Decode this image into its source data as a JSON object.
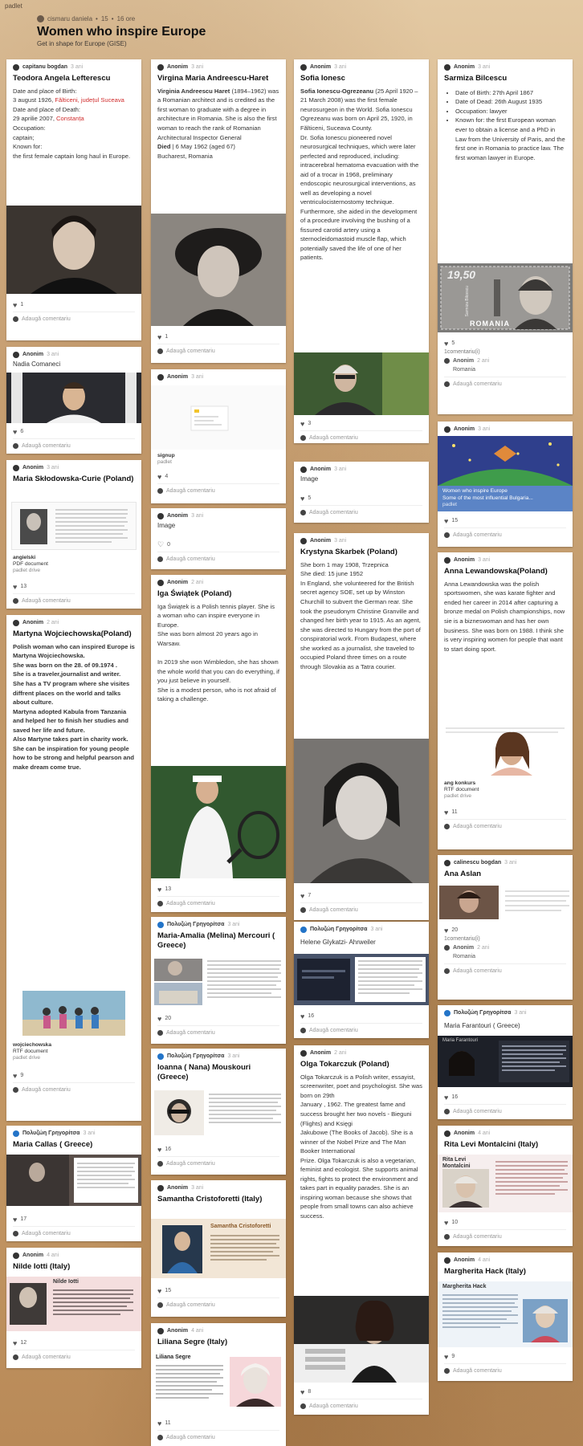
{
  "brand": "padlet",
  "header": {
    "author": "cismaru daniela",
    "likes": "15",
    "age": "16 ore",
    "title": "Women who inspire Europe",
    "subtitle": "Get in shape for Europe (GISE)",
    "dot": "•"
  },
  "ui": {
    "add_comment": "Adaugă comentariu",
    "heart": "♥",
    "heart_empty": "♡"
  },
  "cards": {
    "teodora": {
      "author": "capitanu bogdan",
      "time": "3 ani",
      "title": "Teodora Angela Lefterescu",
      "l1": "Date and place of Birth:",
      "l2a": "3 august 1926, ",
      "l2b": "Fălticeni, județul Suceava",
      "l3": "Date and place of Death:",
      "l4a": "29 aprilie 2007, ",
      "l4b": "Constanța",
      "l5": "Occupation:",
      "l6": "captain;",
      "l7": "Known for:",
      "l8": "the first female captain long haul in Europe.",
      "likes": "1"
    },
    "nadia": {
      "author": "Anonim",
      "time": "3 ani",
      "title": "Nadia Comaneci",
      "likes": "6"
    },
    "curie": {
      "author": "Anonim",
      "time": "3 ani",
      "title": "Maria Skłodowska-Curie (Poland)",
      "file": "angielski",
      "ftype": "PDF document",
      "src": "padlet drive",
      "likes": "13"
    },
    "martyna": {
      "author": "Anonim",
      "time": "2 ani",
      "title": "Martyna Wojciechowska(Poland)",
      "body": "Polish woman who can inspired Europe is Martyna Wojciechowska.\nShe was born on  the 28. of 09.1974 .\nShe is a traveler,journalist and writer.\nShe has  a TV program where she visites diffrent places on the world and talks about culture.\n Martyna adopted Kabula from Tanzania and helped her to finish her studies and saved her life and future.\nAlso Martyne takes part in charity work.\nShe can be inspiration for young people how to be  strong and helpful pearson and make dream come true.",
      "file": "wojciechowska",
      "ftype": "RTF document",
      "src": "padlet drive",
      "likes": "9"
    },
    "callas": {
      "author": "Πολυζώη Γρηγορίτσα",
      "time": "3 ani",
      "title": "Maria Callas ( Greece)",
      "likes": "17"
    },
    "iotti": {
      "author": "Anonim",
      "time": "4 ani",
      "title": "Nilde Iotti (Italy)",
      "caption": "Nilde Iotti",
      "likes": "12"
    },
    "virginia": {
      "author": "Anonim",
      "time": "3 ani",
      "title": "Virgina Maria Andreescu-Haret",
      "bname": "Virginia Andreescu Haret",
      "body": " (1894–1962) was a Romanian architect and is credited as the first woman to graduate with a degree in architecture in Romania. She is also the first woman to reach the rank of Romanian Architectural Inspector General",
      "died": "Died",
      "dieddate": " | 6 May 1962 (aged 67)",
      "place": "Bucharest, Romania",
      "likes": "1"
    },
    "signup": {
      "author": "Anonim",
      "time": "3 ani",
      "link": "signup",
      "src": "padlet",
      "likes": "4"
    },
    "image1": {
      "author": "Anonim",
      "time": "3 ani",
      "title": "Image",
      "likes": "0"
    },
    "iga": {
      "author": "Anonim",
      "time": "2 ani",
      "title": "Iga Świątek (Poland)",
      "body": "Iga Świątek is a Polish tennis player. She is a woman who can inspire everyone in Europe.\nShe was born almost 20 years ago in Warsaw.\n\nIn 2019 she won Wimbledon, she has shown the whole world that you can do everything, if you just believe in yourself.\nShe is a modest person, who is not afraid of taking a challenge.",
      "likes": "13"
    },
    "melina": {
      "author": "Πολυζώη Γρηγορίτσα",
      "time": "3 ani",
      "title": "Maria-Amalia (Melina) Mercouri ( Greece)",
      "likes": "20"
    },
    "nana": {
      "author": "Πολυζώη Γρηγορίτσα",
      "time": "3 ani",
      "title": "Ioanna ( Nana) Mouskouri (Greece)",
      "likes": "16"
    },
    "samantha": {
      "author": "Anonim",
      "time": "3 ani",
      "title": "Samantha Cristoforetti (Italy)",
      "caption": "Samantha Cristoforetti",
      "likes": "15"
    },
    "liliana": {
      "author": "Anonim",
      "time": "4 ani",
      "title": "Liliana Segre (Italy)",
      "caption": "Liliana Segre",
      "likes": "11"
    },
    "sofia": {
      "author": "Anonim",
      "time": "3 ani",
      "title": "Sofia Ionesc",
      "bname": "Sofia Ionescu-Ogrezeanu",
      "body": " (25 April 1920 – 21 March 2008) was the first female neurosurgeon in the World. Sofia Ionescu Ogrezeanu was born on April 25, 1920, in Fălticeni, Suceava County.\nDr. Sofia Ionescu pioneered novel neurosurgical techniques, which were later perfected and reproduced, including: intracerebral hematoma evacuation with the aid of a trocar in 1968, preliminary endoscopic neurosurgical interventions, as well as developing a novel ventriculocisternostomy technique. Furthermore, she aided in the development of a procedure involving the bushing of a fissured carotid artery using a sternocleidomastoid muscle flap, which potentially saved the life of one of her patients.",
      "likes": "3"
    },
    "image2": {
      "author": "Anonim",
      "time": "3 ani",
      "title": "Image",
      "likes": "5"
    },
    "krystyna": {
      "author": "Anonim",
      "time": "3 ani",
      "title": "Krystyna Skarbek (Poland)",
      "body": "She born 1 may 1908, Trzepnica\nShe died: 15 june 1952\nIn England, she volunteered for the British secret agency SOE, set up by Winston Churchill to subvert the German rear. She took the pseudonym Christine Granville and changed her birth year to 1915. As an agent, she was directed to Hungary from the port of conspiratorial work. From Budapest, where she worked as a journalist, she traveled to occupied Poland three times on a route through Slovakia as a Tatra courier.",
      "likes": "7"
    },
    "helene": {
      "author": "Πολυζώη Γρηγορίτσα",
      "time": "3 ani",
      "title": "Helene Glykatzi- Ahrweiler",
      "likes": "16"
    },
    "olga": {
      "author": "Anonim",
      "time": "2 ani",
      "title": "Olga Tokarczuk (Poland)",
      "body": "Olga Tokarczuk is a Polish writer, essayist, screenwriter, poet and psychologist. She was born on 29th\nJanuary , 1962. The greatest fame and success brought her two novels - Biegunі (Flights) and Księgi\nJakubowe (The Books of Jacob). She is a winner of the Nobel Prize and The Man Booker International\nPrize. Olga Tokarczuk is also a vegetarian, feminist and ecologist. She supports animal rights, fights to protect the environment and takes part in equality parades. She is an inspiring woman because she shows that people from small towns can also achieve success.",
      "likes": "8"
    },
    "sarmiza": {
      "author": "Anonim",
      "time": "3 ani",
      "title": "Sarmiza Bilcescu",
      "items": [
        "Date of Birth: 27th April 1867",
        "Date of Dead: 26th August 1935",
        "Occupation: lawyer",
        "Known for: the first European woman ever to obtain a license and a PhD in Law from the University of Paris, and the first one in Romania to practice law. The first woman lawyer in Europe."
      ],
      "stamp_value": "19,50",
      "stamp_country": "ROMANIA",
      "stamp_name": "Sarmiza Bilcescu",
      "likes": "5",
      "comments": "1comentariu(i)",
      "c_author": "Anonim",
      "c_time": "2 ani",
      "c_text": "Romania"
    },
    "womenimg": {
      "author": "Anonim",
      "time": "3 ani",
      "cap1": "Women who inspire Europe",
      "cap2": "Some of the most influential Bulgaria...",
      "cap3": "padlet",
      "likes": "15"
    },
    "anna": {
      "author": "Anonim",
      "time": "3 ani",
      "title": "Anna Lewandowska(Poland)",
      "body": "Anna Lewandowska was the polish sportswomen, she was karate fighter and ended her career in  2014  after capturing a bronze medal on Polish championships, now sie is a bizneswoman and has her own business. She was born on 1988. I think she is very inspiring women for people that want to start doing sport.",
      "file": "ang konkurs",
      "ftype": "RTF document",
      "src": "padlet drive",
      "likes": "11"
    },
    "ana": {
      "author": "calinescu bogdan",
      "time": "3 ani",
      "title": "Ana Aslan",
      "likes": "20",
      "comments": "1comentariu(i)",
      "c_author": "Anonim",
      "c_time": "2 ani",
      "c_text": "Romania"
    },
    "farantouri": {
      "author": "Πολυζώη Γρηγορίτσα",
      "time": "3 ani",
      "title": "Maria Farantouri ( Greece)",
      "doc_title": "Maria Farantouri",
      "likes": "16"
    },
    "rita": {
      "author": "Anonim",
      "time": "4 ani",
      "title": "Rita Levi Montalcini (Italy)",
      "caption": "Rita Levi Montalcini",
      "likes": "10"
    },
    "margherita": {
      "author": "Anonim",
      "time": "4 ani",
      "title": "Margherita Hack (Italy)",
      "caption": "Margherita Hack",
      "likes": "9"
    }
  }
}
